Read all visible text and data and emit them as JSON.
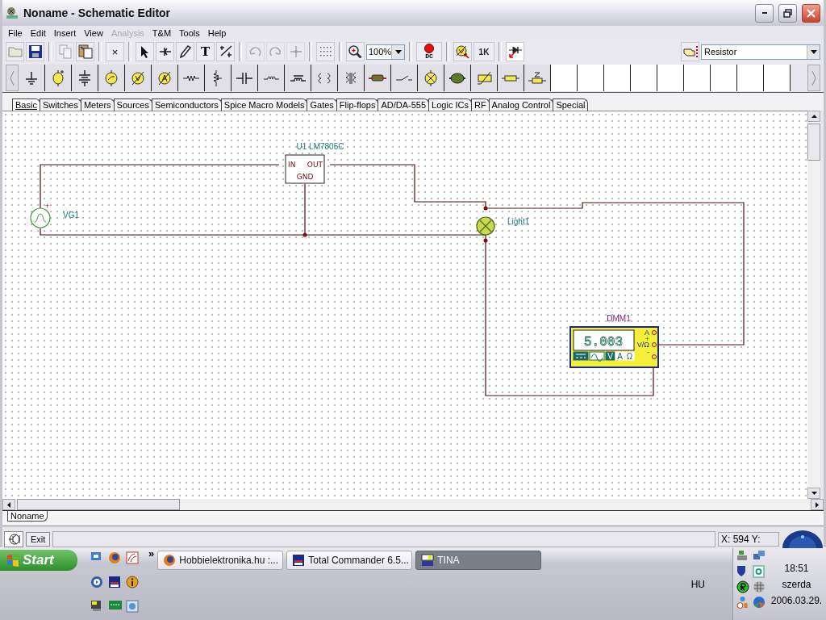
{
  "window": {
    "title": "Noname - Schematic Editor"
  },
  "menu": [
    {
      "label": "File",
      "disabled": false
    },
    {
      "label": "Edit",
      "disabled": false
    },
    {
      "label": "Insert",
      "disabled": false
    },
    {
      "label": "View",
      "disabled": false
    },
    {
      "label": "Analysis",
      "disabled": true
    },
    {
      "label": "T&M",
      "disabled": false
    },
    {
      "label": "Tools",
      "disabled": false
    },
    {
      "label": "Help",
      "disabled": false
    }
  ],
  "toolbar": {
    "groups": [
      {
        "buttons": [
          {
            "kind": "open",
            "disabled": false
          },
          {
            "kind": "save",
            "disabled": false
          }
        ]
      },
      {
        "buttons": [
          {
            "kind": "copy",
            "disabled": true
          },
          {
            "kind": "paste",
            "disabled": false
          }
        ]
      },
      {
        "buttons": [
          {
            "kind": "delete",
            "label": "×",
            "disabled": false
          }
        ]
      },
      {
        "buttons": [
          {
            "kind": "select",
            "disabled": false
          },
          {
            "kind": "wire",
            "disabled": false
          },
          {
            "kind": "pencil",
            "disabled": false
          },
          {
            "kind": "text",
            "label": "T",
            "disabled": false
          },
          {
            "kind": "line",
            "disabled": false
          }
        ]
      },
      {
        "buttons": [
          {
            "kind": "undo",
            "disabled": true
          },
          {
            "kind": "redo",
            "disabled": true
          },
          {
            "kind": "junction",
            "disabled": true
          }
        ]
      },
      {
        "buttons": [
          {
            "kind": "grid",
            "disabled": false
          }
        ]
      },
      {
        "buttons": [
          {
            "kind": "zoom",
            "disabled": false
          },
          {
            "kind": "zoom_select",
            "value": "100%"
          }
        ]
      },
      {
        "buttons": [
          {
            "kind": "dc",
            "label": "DC",
            "disabled": false
          }
        ]
      },
      {
        "buttons": [
          {
            "kind": "meter",
            "disabled": false
          },
          {
            "kind": "parameter",
            "label": "1K",
            "disabled": false
          }
        ]
      },
      {
        "buttons": [
          {
            "kind": "diode",
            "disabled": false
          }
        ]
      }
    ],
    "component_selector": {
      "value": "Resistor"
    }
  },
  "component_tabs": [
    {
      "label": "Basic",
      "selected": true
    },
    {
      "label": "Switches",
      "selected": false
    },
    {
      "label": "Meters",
      "selected": false
    },
    {
      "label": "Sources",
      "selected": false
    },
    {
      "label": "Semiconductors",
      "selected": false
    },
    {
      "label": "Spice Macro Models",
      "selected": false
    },
    {
      "label": "Gates",
      "selected": false
    },
    {
      "label": "Flip-flops",
      "selected": false
    },
    {
      "label": "AD/DA-555",
      "selected": false
    },
    {
      "label": "Logic ICs",
      "selected": false
    },
    {
      "label": "RF",
      "selected": false
    },
    {
      "label": "Analog Control",
      "selected": false
    },
    {
      "label": "Special",
      "selected": false
    }
  ],
  "schematic": {
    "regulator": {
      "label": "U1 LM7805C",
      "pins": [
        "IN",
        "OUT",
        "GND"
      ]
    },
    "source": {
      "label": "VG1",
      "polarity": "+"
    },
    "lamp": {
      "label": "Light1"
    },
    "multimeter": {
      "label": "DMM1",
      "reading": "5.003",
      "terminals": [
        "A",
        "+",
        "V/Ω",
        "-"
      ],
      "coupling": [
        {
          "kind": "dc",
          "selected": true
        },
        {
          "kind": "ac",
          "selected": false
        }
      ],
      "modes": [
        {
          "label": "V",
          "selected": true
        },
        {
          "label": "A",
          "selected": false
        },
        {
          "label": "Ω",
          "selected": false
        }
      ]
    }
  },
  "document_tabs": [
    {
      "label": "Noname",
      "selected": true
    }
  ],
  "status_bar": {
    "button": "Exit",
    "coordinates": "X: 594 Y:"
  },
  "taskbar": {
    "start": "Start",
    "more": "»",
    "tasks": [
      {
        "label": "Hobbielektronika.hu :...",
        "selected": false
      },
      {
        "label": "Total Commander 6.5...",
        "selected": false
      },
      {
        "label": "TINA",
        "selected": true
      }
    ],
    "language": "HU",
    "clock": {
      "time": "18:51",
      "day": "szerda",
      "date": "2006.03.29."
    }
  }
}
